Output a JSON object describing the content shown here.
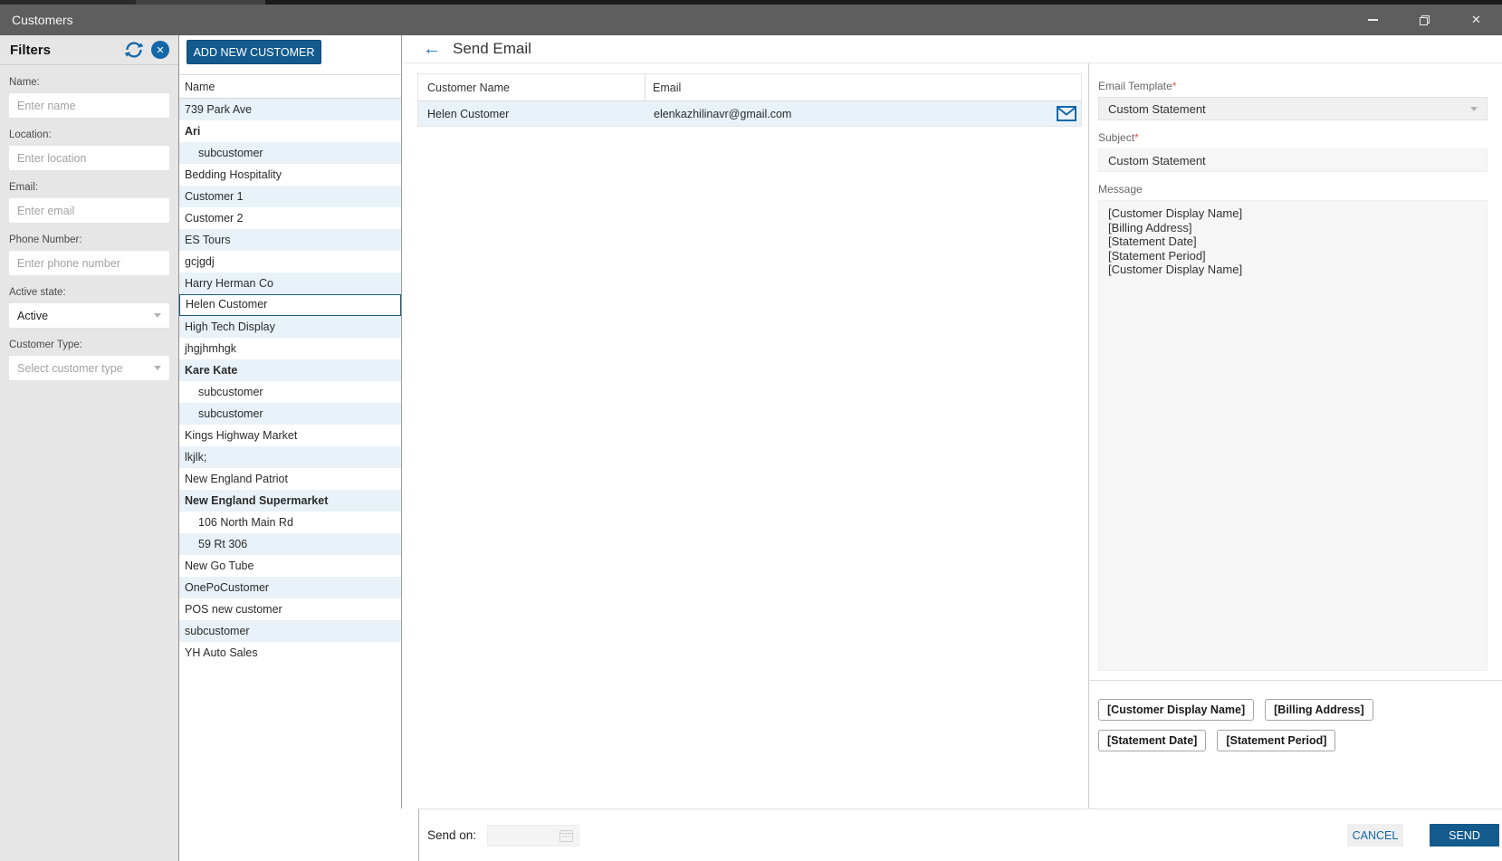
{
  "window": {
    "title": "Customers",
    "icons": {
      "back": "←",
      "close": "✕"
    }
  },
  "colors": {
    "accent_blue": "#135a8d",
    "link_blue": "#1467a8",
    "selected_border": "#1b587d",
    "row_highlight": "#e9f2f8",
    "required_red": "#e8544a",
    "titlebar_gray": "#5e5e5e"
  },
  "filters": {
    "title": "Filters",
    "fields": [
      {
        "label": "Name:",
        "placeholder": "Enter name"
      },
      {
        "label": "Location:",
        "placeholder": "Enter location"
      },
      {
        "label": "Email:",
        "placeholder": "Enter email"
      },
      {
        "label": "Phone Number:",
        "placeholder": "Enter phone number"
      },
      {
        "label": "Active state:",
        "value": "Active"
      },
      {
        "label": "Customer Type:",
        "placeholder": "Select customer type"
      }
    ]
  },
  "customer_list": {
    "add_button": "ADD NEW CUSTOMER",
    "header": "Name",
    "rows": [
      {
        "name": "739 Park Ave"
      },
      {
        "name": "Ari",
        "bold": true
      },
      {
        "name": "subcustomer",
        "indent": true
      },
      {
        "name": "Bedding Hospitality"
      },
      {
        "name": "Customer 1"
      },
      {
        "name": "Customer 2"
      },
      {
        "name": "ES Tours"
      },
      {
        "name": "gcjgdj"
      },
      {
        "name": "Harry Herman Co"
      },
      {
        "name": "Helen Customer",
        "selected": true
      },
      {
        "name": "High Tech Display"
      },
      {
        "name": "jhgjhmhgk"
      },
      {
        "name": "Kare Kate",
        "bold": true
      },
      {
        "name": "subcustomer",
        "indent": true
      },
      {
        "name": "subcustomer",
        "indent": true
      },
      {
        "name": "Kings Highway Market"
      },
      {
        "name": "lkjlk;"
      },
      {
        "name": "New England Patriot"
      },
      {
        "name": "New England Supermarket",
        "bold": true
      },
      {
        "name": "106 North Main Rd",
        "indent": true
      },
      {
        "name": "59 Rt 306",
        "indent": true
      },
      {
        "name": "New Go Tube"
      },
      {
        "name": "OnePoCustomer"
      },
      {
        "name": "POS new customer"
      },
      {
        "name": "subcustomer"
      },
      {
        "name": "YH Auto Sales"
      }
    ]
  },
  "send_email": {
    "title": "Send Email",
    "table": {
      "columns": [
        "Customer Name",
        "Email"
      ],
      "rows": [
        {
          "customer_name": "Helen Customer",
          "email": "elenkazhilinavr@gmail.com"
        }
      ]
    },
    "form": {
      "required_marker": "*",
      "email_template": {
        "label": "Email Template",
        "value": "Custom Statement"
      },
      "subject": {
        "label": "Subject",
        "value": "Custom Statement"
      },
      "message": {
        "label": "Message",
        "value": "[Customer Display Name]\n[Billing Address]\n[Statement Date]\n[Statement Period]\n[Customer Display Name]"
      },
      "tags": [
        "[Customer Display Name]",
        "[Billing Address]",
        "[Statement Date]",
        "[Statement Period]"
      ]
    },
    "footer": {
      "send_on_label": "Send on:",
      "cancel": "CANCEL",
      "send": "SEND"
    }
  }
}
